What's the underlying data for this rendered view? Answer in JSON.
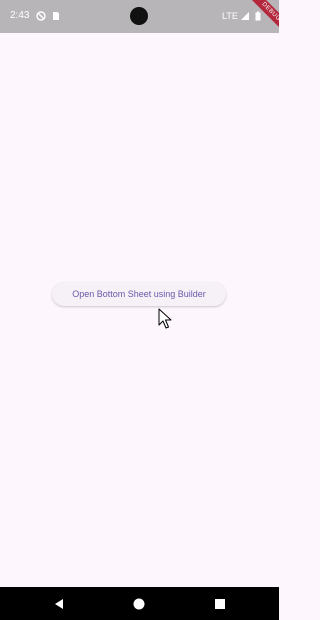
{
  "status_bar": {
    "time": "2:43",
    "network": "LTE",
    "icons": [
      "vpn-icon",
      "sim-card-icon",
      "signal-icon",
      "battery-icon"
    ]
  },
  "debug_banner": {
    "label": "DEBUG"
  },
  "main": {
    "button_label": "Open Bottom Sheet using Builder"
  },
  "nav_bar": {
    "icons": [
      "back-icon",
      "home-icon",
      "recents-icon"
    ]
  },
  "colors": {
    "status_bar": "#b8b5b8",
    "background": "#fdf7fd",
    "button_text": "#6a59a8",
    "debug_ribbon": "#b3283c"
  }
}
